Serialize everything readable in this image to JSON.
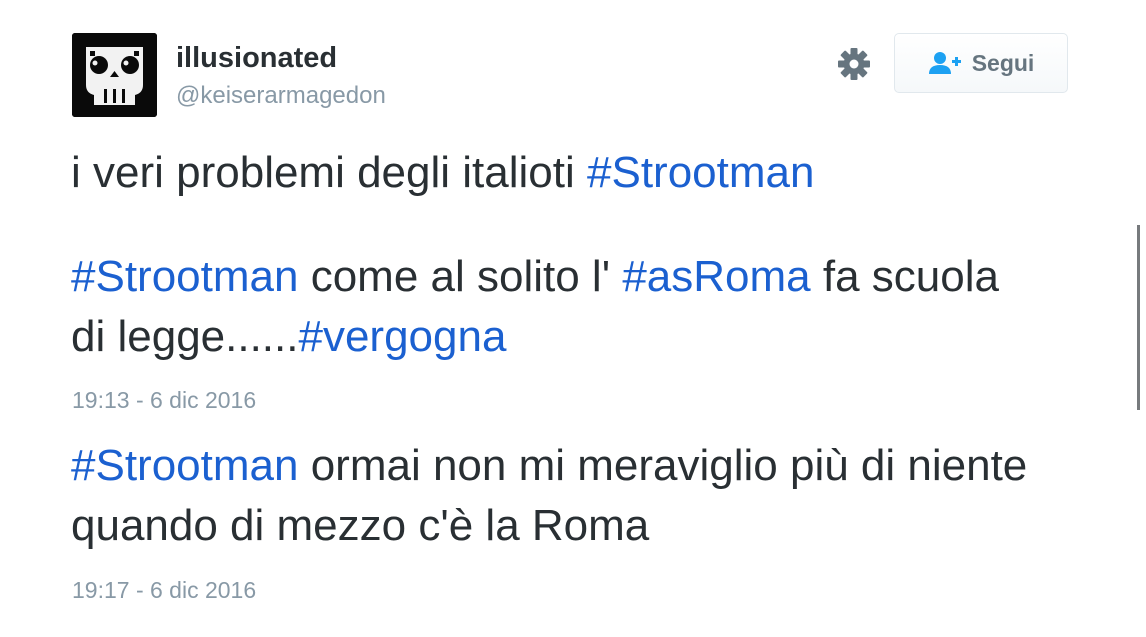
{
  "profile": {
    "name": "illusionated",
    "handle": "@keiserarmagedon"
  },
  "follow_button": {
    "label": "Segui"
  },
  "tweet1": {
    "text_a": "i veri problemi degli italioti ",
    "hashtag_a": "#Strootman",
    "hashtag_b": "#Strootman",
    "text_b": " come al solito l' ",
    "hashtag_c": "#asRoma",
    "text_c": " fa scuola di legge......",
    "hashtag_d": "#vergogna",
    "time": "19:13 - 6 dic 2016"
  },
  "tweet2": {
    "hashtag_a": "#Strootman",
    "text_a": " ormai non mi meraviglio più di niente quando di mezzo c'è la Roma",
    "time": "19:17 - 6 dic 2016"
  },
  "colors": {
    "hashtag": "#1b60d0",
    "text": "#292f33",
    "muted": "#8899a6",
    "follow_icon": "#1da1f2"
  },
  "icons": [
    "avatar-skull-icon",
    "gear-icon",
    "follow-user-icon"
  ]
}
